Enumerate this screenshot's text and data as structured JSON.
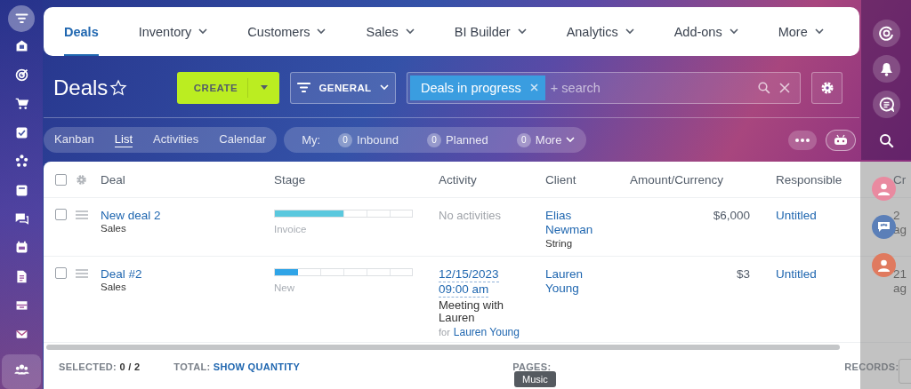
{
  "sidebar": {
    "items": [
      {
        "selected": true
      },
      {
        "selected": false
      },
      {
        "selected": false
      },
      {
        "selected": false
      },
      {
        "selected": false
      },
      {
        "selected": false
      },
      {
        "selected": false
      },
      {
        "selected": false
      },
      {
        "selected": false
      },
      {
        "selected": false
      },
      {
        "selected": false
      },
      {
        "selected": false
      },
      {
        "selected": false
      }
    ]
  },
  "top_nav": [
    {
      "label": "Deals",
      "selected": true,
      "has_menu": false
    },
    {
      "label": "Inventory",
      "selected": false,
      "has_menu": true
    },
    {
      "label": "Customers",
      "selected": false,
      "has_menu": true
    },
    {
      "label": "Sales",
      "selected": false,
      "has_menu": true
    },
    {
      "label": "BI Builder",
      "selected": false,
      "has_menu": true
    },
    {
      "label": "Analytics",
      "selected": false,
      "has_menu": true
    },
    {
      "label": "Add-ons",
      "selected": false,
      "has_menu": true
    },
    {
      "label": "More",
      "selected": false,
      "has_menu": true
    }
  ],
  "page_title": "Deals",
  "favorite": false,
  "create_button": "CREATE",
  "filter_button": "GENERAL",
  "search": {
    "tags": [
      "Deals in progress"
    ],
    "placeholder": "+ search"
  },
  "view_tabs": [
    {
      "label": "Kanban",
      "selected": false
    },
    {
      "label": "List",
      "selected": true
    },
    {
      "label": "Activities",
      "selected": false
    },
    {
      "label": "Calendar",
      "selected": false
    }
  ],
  "counters_label": "My:",
  "counters": [
    {
      "count": "0",
      "label": "Inbound",
      "has_menu": false
    },
    {
      "count": "0",
      "label": "Planned",
      "has_menu": false
    },
    {
      "count": "0",
      "label": "More",
      "has_menu": true
    }
  ],
  "table": {
    "columns": [
      "Deal",
      "Stage",
      "Activity",
      "Client",
      "Amount/Currency",
      "Responsible",
      "Cr"
    ],
    "select_all_checked": false,
    "rows": [
      {
        "checked": false,
        "deal": "New deal 2",
        "pipeline": "Sales",
        "stage": {
          "label": "Invoice",
          "level": 0.5,
          "color": "#5ac8de"
        },
        "activity": {
          "kind": "none",
          "text": "No activities"
        },
        "client": {
          "name": "Elias Newman",
          "company": "String"
        },
        "amount": "$6,000",
        "responsible": "Untitled",
        "created": [
          "2",
          "ag"
        ]
      },
      {
        "checked": false,
        "deal": "Deal #2",
        "pipeline": "Sales",
        "stage": {
          "label": "New",
          "level": 0.167,
          "color": "#2fa4e7"
        },
        "activity": {
          "kind": "scheduled",
          "date": "12/15/2023",
          "time": "09:00 am",
          "subject": "Meeting with Lauren",
          "for_label": "for",
          "for_name": "Lauren Young"
        },
        "client": {
          "name": "Lauren Young"
        },
        "amount": "$3",
        "responsible": "Untitled",
        "created": [
          "21",
          "ag"
        ]
      }
    ]
  },
  "footer": {
    "selected_label": "SELECTED:",
    "selected_value": "0 / 2",
    "total_label": "TOTAL:",
    "total_link": "SHOW QUANTITY",
    "pages_label": "PAGES:",
    "records_label": "RECORDS:"
  },
  "side_panel": {
    "avatars": [
      {
        "kind": "person",
        "color": "#e98aa0"
      },
      {
        "kind": "group",
        "color": "#5b7fb8"
      },
      {
        "kind": "person",
        "color": "#e07a5f"
      }
    ]
  },
  "tooltip": "Music"
}
